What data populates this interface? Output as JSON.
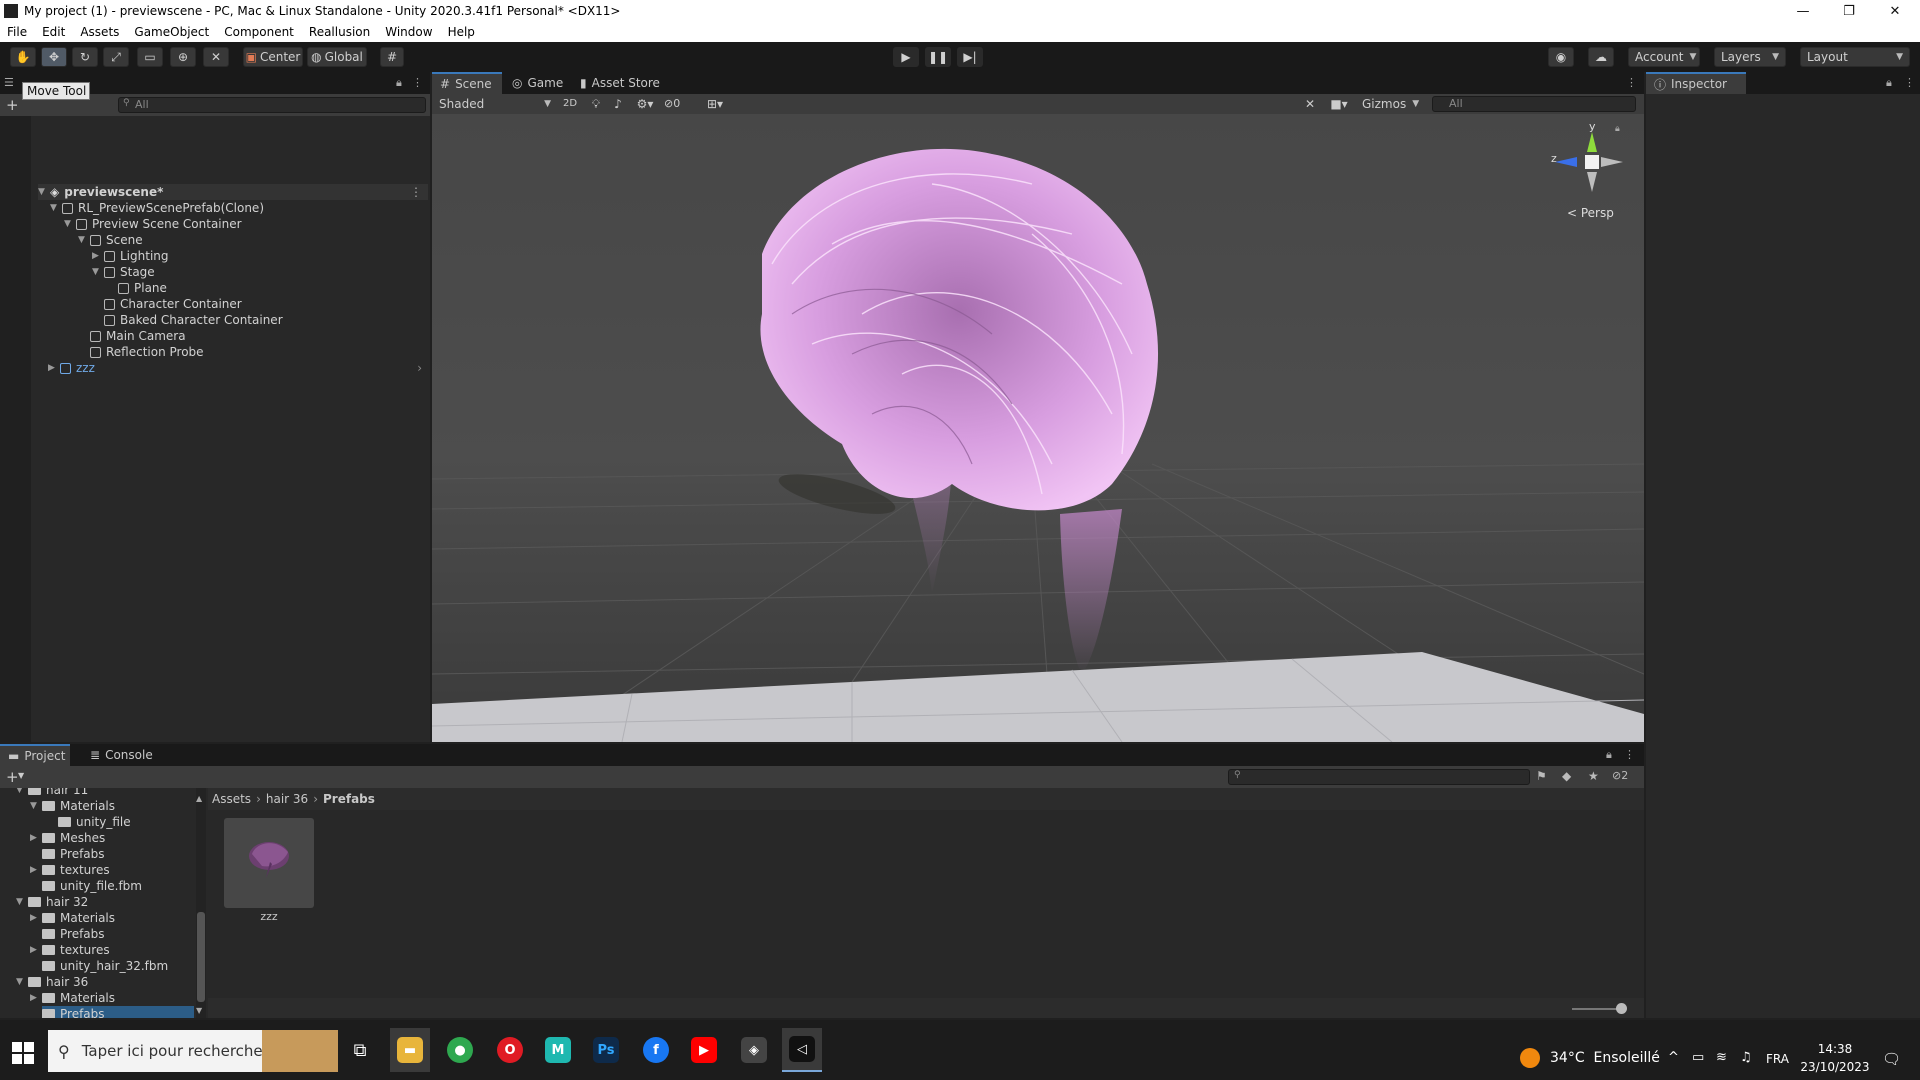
{
  "window": {
    "title": "My project (1) - previewscene - PC, Mac & Linux Standalone - Unity 2020.3.41f1 Personal* <DX11>",
    "minimize": "—",
    "maximize": "❐",
    "close": "✕"
  },
  "menu": [
    "File",
    "Edit",
    "Assets",
    "GameObject",
    "Component",
    "Reallusion",
    "Window",
    "Help"
  ],
  "toolbar": {
    "pivot_label": "Center",
    "space_label": "Global",
    "account_label": "Account",
    "layers_label": "Layers",
    "layout_label": "Layout",
    "tooltip": "Move Tool"
  },
  "hierarchy": {
    "search_placeholder": "All",
    "scene_name": "previewscene*",
    "items": [
      {
        "label": "RL_PreviewScenePrefab(Clone)"
      },
      {
        "label": "Preview Scene Container"
      },
      {
        "label": "Scene"
      },
      {
        "label": "Lighting"
      },
      {
        "label": "Stage"
      },
      {
        "label": "Plane"
      },
      {
        "label": "Character Container"
      },
      {
        "label": "Baked Character Container"
      },
      {
        "label": "Main Camera"
      },
      {
        "label": "Reflection Probe"
      },
      {
        "label": "zzz"
      }
    ]
  },
  "scene_tabs": [
    "Scene",
    "Game",
    "Asset Store"
  ],
  "scene_toolbar": {
    "shading": "Shaded",
    "mode_2d": "2D",
    "hidden_count": "0",
    "gizmos": "Gizmos",
    "search_placeholder": "All",
    "projection": "< Persp",
    "axis_y": "y",
    "axis_z": "z"
  },
  "inspector": {
    "title": "Inspector"
  },
  "bottom_tabs": [
    "Project",
    "Console"
  ],
  "project": {
    "tree": [
      {
        "label": "hair 11"
      },
      {
        "label": "Materials"
      },
      {
        "label": "unity_file"
      },
      {
        "label": "Meshes"
      },
      {
        "label": "Prefabs"
      },
      {
        "label": "textures"
      },
      {
        "label": "unity_file.fbm"
      },
      {
        "label": "hair 32"
      },
      {
        "label": "Materials"
      },
      {
        "label": "Prefabs"
      },
      {
        "label": "textures"
      },
      {
        "label": "unity_hair_32.fbm"
      },
      {
        "label": "hair 36"
      },
      {
        "label": "Materials"
      },
      {
        "label": "Prefabs"
      }
    ],
    "breadcrumb": [
      "Assets",
      "hair 36",
      "Prefabs"
    ],
    "asset_name": "zzz",
    "hidden_count": "2"
  },
  "taskbar": {
    "search_placeholder": "Taper ici pour rechercher",
    "weather_temp": "34°C",
    "weather_desc": "Ensoleillé",
    "language": "FRA",
    "time": "14:38",
    "date": "23/10/2023"
  },
  "colors": {
    "accent": "#3a79bb",
    "hair": "#e6a6ea",
    "panel": "#282828",
    "scene_bg": "#474747"
  }
}
